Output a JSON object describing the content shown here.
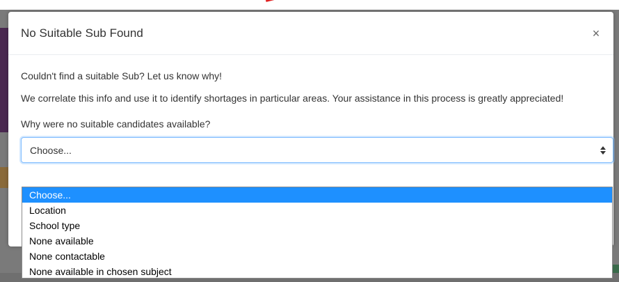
{
  "modal": {
    "title": "No Suitable Sub Found",
    "close_label": "×",
    "intro": "Couldn't find a suitable Sub? Let us know why!",
    "description": "We correlate this info and use it to identify shortages in particular areas. Your assistance in this process is greatly appreciated!",
    "question_label": "Why were no suitable candidates available?",
    "select": {
      "selected": "Choose...",
      "options": [
        "Choose...",
        "Location",
        "School type",
        "None available",
        "None contactable",
        "None available in chosen subject"
      ]
    }
  },
  "colors": {
    "overlay": "#7a7a7a",
    "highlight": "#1e90ff",
    "focus_border": "#80bdff"
  }
}
